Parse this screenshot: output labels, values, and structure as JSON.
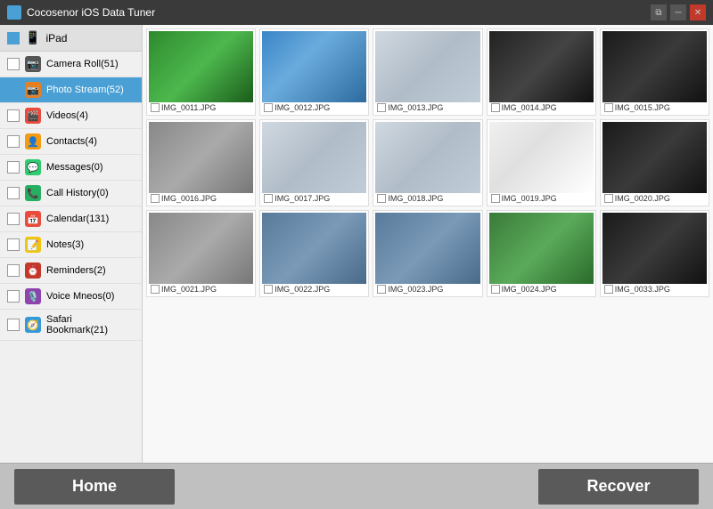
{
  "titleBar": {
    "title": "Cocosenor iOS Data Tuner",
    "controls": [
      "restore",
      "minimize",
      "close"
    ]
  },
  "sidebar": {
    "device": {
      "label": "iPad",
      "checked": true
    },
    "items": [
      {
        "id": "camera-roll",
        "label": "Camera Roll(51)",
        "icon": "camera",
        "checked": false,
        "active": false
      },
      {
        "id": "photo-stream",
        "label": "Photo Stream(52)",
        "icon": "photo",
        "checked": true,
        "active": true
      },
      {
        "id": "videos",
        "label": "Videos(4)",
        "icon": "video",
        "checked": false,
        "active": false
      },
      {
        "id": "contacts",
        "label": "Contacts(4)",
        "icon": "contacts",
        "checked": false,
        "active": false
      },
      {
        "id": "messages",
        "label": "Messages(0)",
        "icon": "messages",
        "checked": false,
        "active": false
      },
      {
        "id": "call-history",
        "label": "Call History(0)",
        "icon": "call",
        "checked": false,
        "active": false
      },
      {
        "id": "calendar",
        "label": "Calendar(131)",
        "icon": "calendar",
        "checked": false,
        "active": false
      },
      {
        "id": "notes",
        "label": "Notes(3)",
        "icon": "notes",
        "checked": false,
        "active": false
      },
      {
        "id": "reminders",
        "label": "Reminders(2)",
        "icon": "reminders",
        "checked": false,
        "active": false
      },
      {
        "id": "voice-memos",
        "label": "Voice Mneos(0)",
        "icon": "voice",
        "checked": false,
        "active": false
      },
      {
        "id": "safari-bookmark",
        "label": "Safari Bookmark(21)",
        "icon": "safari",
        "checked": false,
        "active": false
      }
    ]
  },
  "photos": [
    {
      "id": "img-0011",
      "label": "IMG_0011.JPG",
      "thumb": "green"
    },
    {
      "id": "img-0012",
      "label": "IMG_0012.JPG",
      "thumb": "ios"
    },
    {
      "id": "img-0013",
      "label": "IMG_0013.JPG",
      "thumb": "finder"
    },
    {
      "id": "img-0014",
      "label": "IMG_0014.JPG",
      "thumb": "dark"
    },
    {
      "id": "img-0015",
      "label": "IMG_0015.JPG",
      "thumb": "dark2"
    },
    {
      "id": "img-0016",
      "label": "IMG_0016.JPG",
      "thumb": "gray-ui"
    },
    {
      "id": "img-0017",
      "label": "IMG_0017.JPG",
      "thumb": "finder"
    },
    {
      "id": "img-0018",
      "label": "IMG_0018.JPG",
      "thumb": "finder"
    },
    {
      "id": "img-0019",
      "label": "IMG_0019.JPG",
      "thumb": "book"
    },
    {
      "id": "img-0020",
      "label": "IMG_0020.JPG",
      "thumb": "dark2"
    },
    {
      "id": "img-0021",
      "label": "IMG_0021.JPG",
      "thumb": "gray-ui"
    },
    {
      "id": "img-0022",
      "label": "IMG_0022.JPG",
      "thumb": "images"
    },
    {
      "id": "img-0023",
      "label": "IMG_0023.JPG",
      "thumb": "images"
    },
    {
      "id": "img-0024",
      "label": "IMG_0024.JPG",
      "thumb": "green2"
    },
    {
      "id": "img-0033",
      "label": "IMG_0033.JPG",
      "thumb": "dark2"
    }
  ],
  "footer": {
    "homeLabel": "Home",
    "recoverLabel": "Recover"
  }
}
